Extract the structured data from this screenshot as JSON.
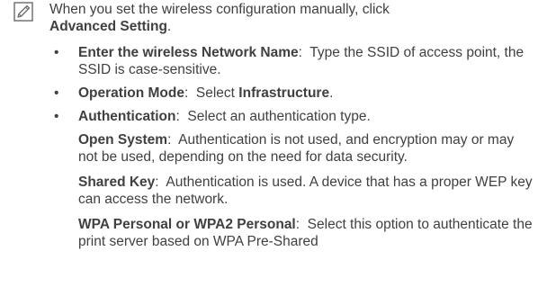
{
  "note": {
    "icon": "pencil-note-icon",
    "intro_text": "When you set the wireless configuration manually, click",
    "intro_bold": "Advanced Setting",
    "intro_end": "."
  },
  "list": {
    "bullet": "•",
    "items": [
      {
        "term": "Enter the wireless Network Name",
        "sep": ":  ",
        "text": "Type the SSID of access point, the SSID is case-sensitive."
      },
      {
        "term": "Operation Mode",
        "sep": ":  ",
        "text": "Select ",
        "bold": "Infrastructure",
        "end": "."
      },
      {
        "term": "Authentication",
        "sep": ":  ",
        "text": "Select an authentication type.",
        "options": [
          {
            "term": "Open System",
            "sep": ":  ",
            "text": "Authentication is not used, and encryption may or may not be used, depending on the need for data security."
          },
          {
            "term": "Shared Key",
            "sep": ":  ",
            "text": "Authentication is used. A device that has a proper WEP key can access the network."
          },
          {
            "term": "WPA Personal or WPA2 Personal",
            "sep": ":  ",
            "text": "Select this option to authenticate the print server based on WPA Pre-Shared"
          }
        ]
      }
    ]
  }
}
